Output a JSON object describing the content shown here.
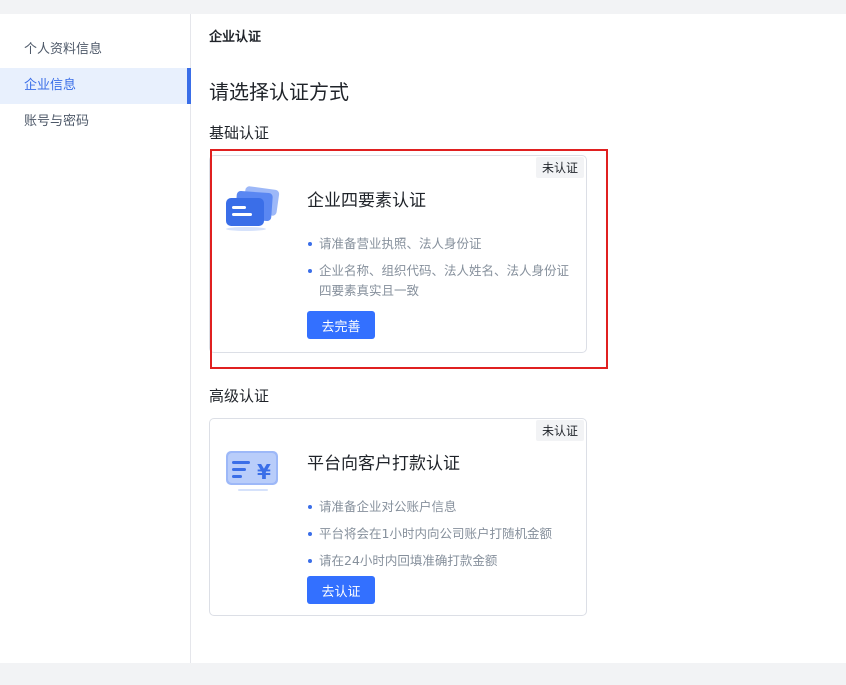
{
  "sidebar": {
    "items": [
      {
        "label": "个人资料信息",
        "active": false
      },
      {
        "label": "企业信息",
        "active": true
      },
      {
        "label": "账号与密码",
        "active": false
      }
    ]
  },
  "breadcrumb": "企业认证",
  "page_title": "请选择认证方式",
  "sections": {
    "basic": {
      "title": "基础认证",
      "card": {
        "badge": "未认证",
        "icon": "cards-stack-icon",
        "title": "企业四要素认证",
        "bullets": [
          "请准备营业执照、法人身份证",
          "企业名称、组织代码、法人姓名、法人身份证四要素真实且一致"
        ],
        "button": "去完善"
      }
    },
    "advanced": {
      "title": "高级认证",
      "card": {
        "badge": "未认证",
        "icon": "bank-transfer-yuan-icon",
        "title": "平台向客户打款认证",
        "bullets": [
          "请准备企业对公账户信息",
          "平台将会在1小时内向公司账户打随机金额",
          "请在24小时内回填准确打款金额"
        ],
        "button": "去认证"
      }
    }
  },
  "colors": {
    "accent": "#3370ff",
    "highlight_border": "#e02020",
    "sidebar_active_bg": "#e8f0fd"
  }
}
